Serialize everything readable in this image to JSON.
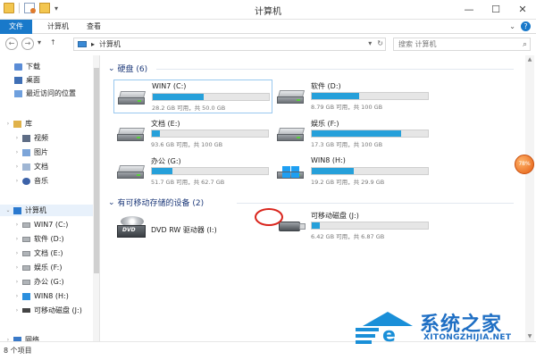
{
  "window": {
    "title": "计算机",
    "minimize": "—",
    "maximize": "☐",
    "close": "✕"
  },
  "ribbon": {
    "tabs": [
      {
        "label": "文件",
        "active": true
      },
      {
        "label": "计算机",
        "active": false
      },
      {
        "label": "查看",
        "active": false
      }
    ],
    "help": "?",
    "collapse": "⌄"
  },
  "address": {
    "back": "←",
    "forward": "→",
    "recent": "▾",
    "up": "↑",
    "separator": "▸",
    "path": "计算机",
    "dropdown": "▾",
    "refresh": "↻",
    "search_placeholder": "搜索 计算机",
    "search_icon": "⌕"
  },
  "sidebar": {
    "items": [
      {
        "label": "下载",
        "icon": "download-icon"
      },
      {
        "label": "桌面",
        "icon": "desktop-icon"
      },
      {
        "label": "最近访问的位置",
        "icon": "recent-places-icon"
      },
      {
        "label": "库",
        "icon": "libraries-icon"
      },
      {
        "label": "视频",
        "icon": "videos-icon"
      },
      {
        "label": "图片",
        "icon": "pictures-icon"
      },
      {
        "label": "文档",
        "icon": "documents-icon"
      },
      {
        "label": "音乐",
        "icon": "music-icon"
      },
      {
        "label": "计算机",
        "icon": "computer-icon"
      },
      {
        "label": "WIN7 (C:)",
        "icon": "drive-icon"
      },
      {
        "label": "软件 (D:)",
        "icon": "drive-icon"
      },
      {
        "label": "文档 (E:)",
        "icon": "drive-icon"
      },
      {
        "label": "娱乐 (F:)",
        "icon": "drive-icon"
      },
      {
        "label": "办公 (G:)",
        "icon": "drive-icon"
      },
      {
        "label": "WIN8 (H:)",
        "icon": "windows-drive-icon"
      },
      {
        "label": "可移动磁盘 (J:)",
        "icon": "usb-drive-icon"
      },
      {
        "label": "网络",
        "icon": "network-icon"
      }
    ]
  },
  "content": {
    "group_hdd": "硬盘 (6)",
    "group_removable": "有可移动存储的设备 (2)",
    "drives": [
      {
        "name": "WIN7 (C:)",
        "info": "28.2 GB 可用，共 50.0 GB",
        "used": 0.44
      },
      {
        "name": "软件 (D:)",
        "info": "8.79 GB 可用，共 100 GB",
        "used": 0.41
      },
      {
        "name": "文档 (E:)",
        "info": "93.6 GB 可用，共 100 GB",
        "used": 0.07
      },
      {
        "name": "娱乐 (F:)",
        "info": "17.3 GB 可用，共 100 GB",
        "used": 0.77
      },
      {
        "name": "办公 (G:)",
        "info": "51.7 GB 可用，共 62.7 GB",
        "used": 0.18
      },
      {
        "name": "WIN8 (H:)",
        "info": "19.2 GB 可用，共 29.9 GB",
        "used": 0.36
      }
    ],
    "dvd": {
      "name": "DVD RW 驱动器 (I:)",
      "badge": "DVD"
    },
    "usb": {
      "name": "可移动磁盘 (J:)",
      "info": "6.42 GB 可用，共 6.87 GB",
      "used": 0.07
    }
  },
  "badge": "78%",
  "status": {
    "count": "8 个项目"
  },
  "watermark": {
    "title": "系统之家",
    "url": "XITONGZHIJIA.NET",
    "logo_letter": "e"
  }
}
